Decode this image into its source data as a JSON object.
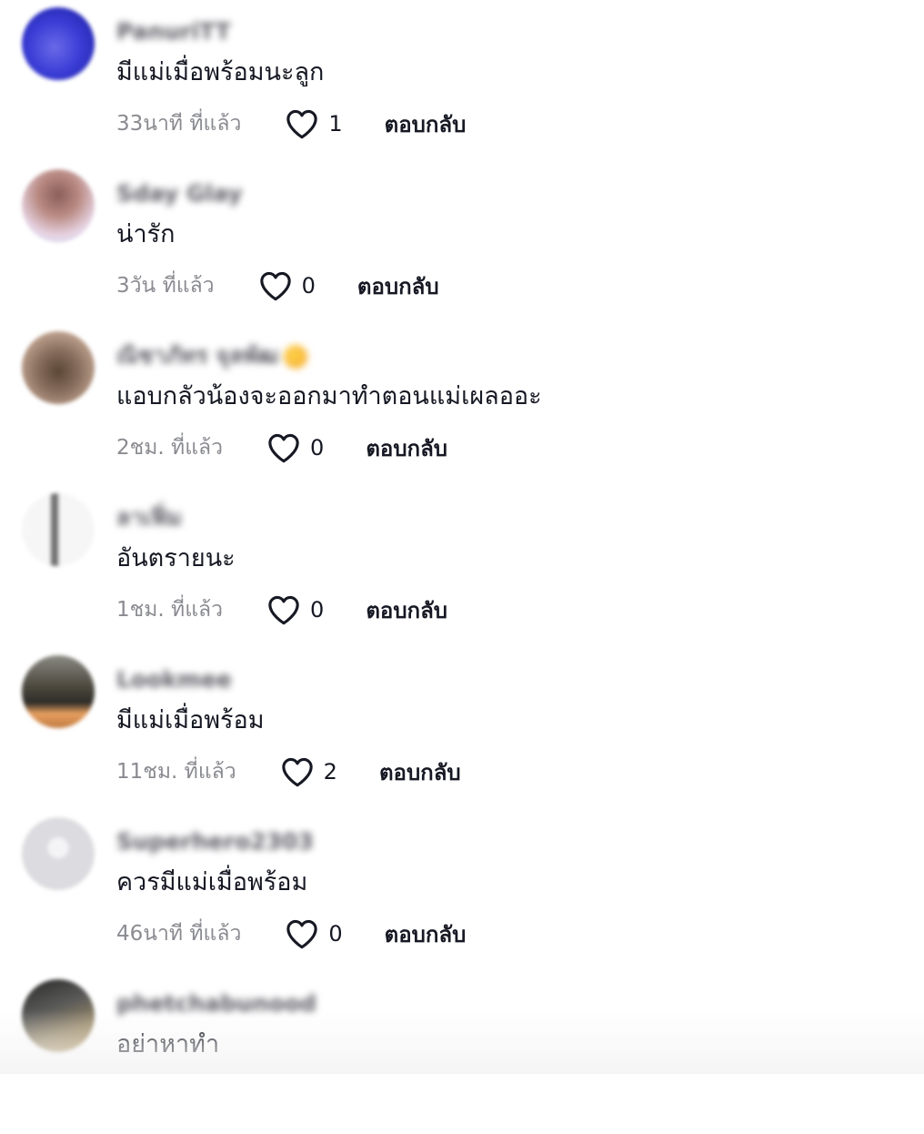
{
  "reply_label": "ตอบกลับ",
  "comments": [
    {
      "username": "PanuriTT",
      "text": "มีแม่เมื่อพร้อมนะลูก",
      "time": "33นาที ที่แล้ว",
      "likes": "1",
      "avatar_colors": [
        "#3b3ed6",
        "#1a1c9e"
      ]
    },
    {
      "username": "Sday Glay",
      "text": "น่ารัก",
      "time": "3วัน ที่แล้ว",
      "likes": "0",
      "avatar_colors": [
        "#e8d6e6",
        "#8b5e5a"
      ]
    },
    {
      "username": "ณิชาภัทร จุลพัฒ",
      "text": "แอบกลัวน้องจะออกมาทำตอนแม่เผลออะ",
      "time": "2ชม. ที่แล้ว",
      "likes": "0",
      "avatar_colors": [
        "#c9ab97",
        "#5a4636"
      ]
    },
    {
      "username": "ลาเฟิ่ม",
      "text": "อันตรายนะ",
      "time": "1ชม. ที่แล้ว",
      "likes": "0",
      "avatar_colors": [
        "#f4f4f4",
        "#7a7a7a"
      ]
    },
    {
      "username": "Lookmee",
      "text": "มีแม่เมื่อพร้อม",
      "time": "11ชม. ที่แล้ว",
      "likes": "2",
      "avatar_colors": [
        "#e8a060",
        "#4a463c"
      ]
    },
    {
      "username": "Superhero2303",
      "text": "ควรมีแม่เมื่อพร้อม",
      "time": "46นาที ที่แล้ว",
      "likes": "0",
      "avatar_colors": [
        "#e6e6e9",
        "#d0d0d4"
      ]
    },
    {
      "username": "phetchabunood",
      "text": "อย่าหาทำ",
      "time": "",
      "likes": "",
      "avatar_colors": [
        "#3a3a3a",
        "#b59a62"
      ]
    }
  ],
  "colors": {
    "text": "#161823",
    "secondary": "#8a8b91",
    "background": "#ffffff"
  },
  "icons": {
    "like": "heart-icon"
  }
}
